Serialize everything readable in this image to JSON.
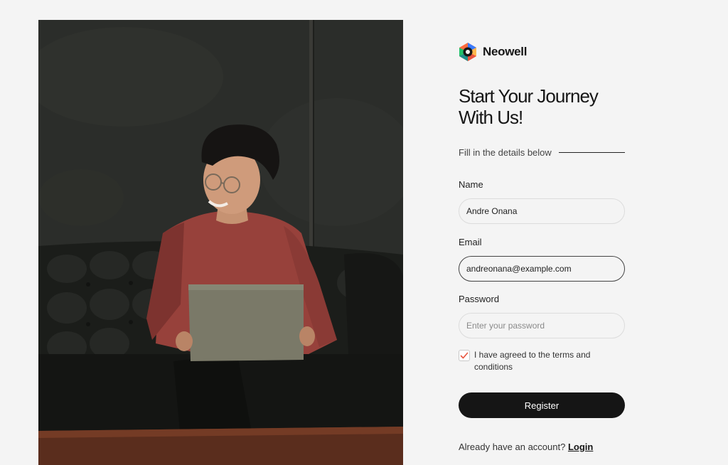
{
  "brand": {
    "name": "Neowell",
    "logo_icon": "hexagon-logo-icon"
  },
  "hero": {
    "image": "person-with-laptop-on-leather-sofa-photo"
  },
  "form": {
    "title_line1": "Start Your Journey",
    "title_line2": "With Us!",
    "subtitle": "Fill in the details below",
    "name": {
      "label": "Name",
      "value": "Andre Onana"
    },
    "email": {
      "label": "Email",
      "value": "andreonana@example.com"
    },
    "password": {
      "label": "Password",
      "value": "",
      "placeholder": "Enter your password"
    },
    "terms": {
      "checked": true,
      "text": "I have agreed to the terms and conditions"
    },
    "register_label": "Register",
    "login_prompt": "Already have an account?",
    "login_link": "Login"
  },
  "colors": {
    "accent": "#e8553f",
    "button": "#151515",
    "background": "#f4f4f4"
  }
}
